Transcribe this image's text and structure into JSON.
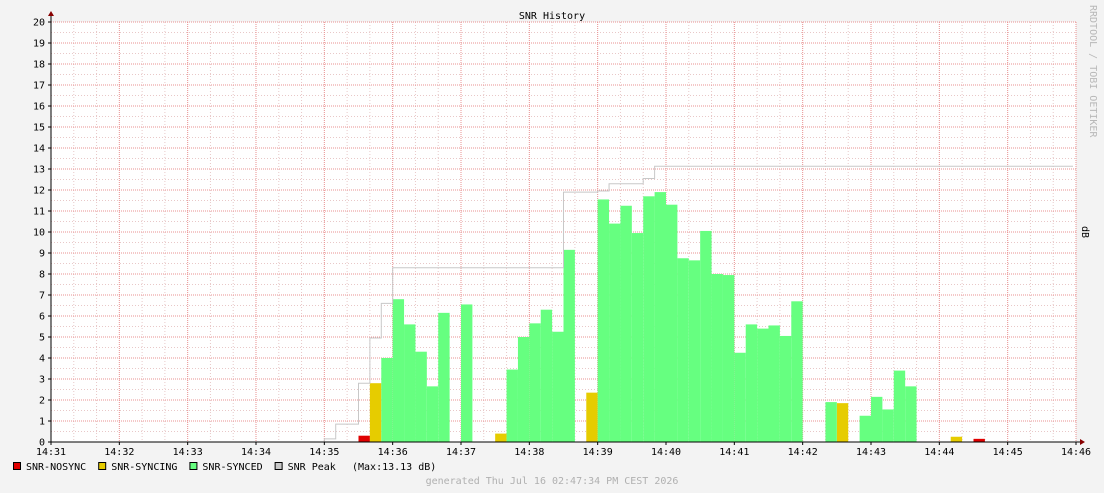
{
  "chart_data": {
    "type": "bar",
    "title": "SNR History",
    "ylabel": "dB",
    "ylim": [
      0,
      20
    ],
    "yticks": [
      0,
      1,
      2,
      3,
      4,
      5,
      6,
      7,
      8,
      9,
      10,
      11,
      12,
      13,
      14,
      15,
      16,
      17,
      18,
      19,
      20
    ],
    "xlim": [
      "14:31",
      "14:46"
    ],
    "xticks": [
      "14:31",
      "14:32",
      "14:33",
      "14:34",
      "14:35",
      "14:36",
      "14:37",
      "14:38",
      "14:39",
      "14:40",
      "14:41",
      "14:42",
      "14:43",
      "14:44",
      "14:45",
      "14:46"
    ],
    "grid": true,
    "colors": {
      "nosync": "#e00000",
      "syncing": "#e6cc00",
      "synced": "#66ff80",
      "peak": "#c8c8c8",
      "grid_minor": "#e8c8c8",
      "grid_major": "#e89090",
      "axis": "#000000",
      "arrow": "#880000"
    },
    "series": [
      {
        "name": "SNR-NOSYNC",
        "color": "#e00000",
        "points": [
          {
            "x": "14:35:35",
            "y": 0.3
          },
          {
            "x": "14:44:35",
            "y": 0.15
          }
        ]
      },
      {
        "name": "SNR-SYNCING",
        "color": "#e6cc00",
        "points": [
          {
            "x": "14:35:45",
            "y": 2.8
          },
          {
            "x": "14:37:35",
            "y": 0.4
          },
          {
            "x": "14:38:55",
            "y": 2.35
          },
          {
            "x": "14:42:35",
            "y": 1.85
          },
          {
            "x": "14:44:15",
            "y": 0.25
          }
        ]
      },
      {
        "name": "SNR-SYNCED",
        "color": "#66ff80",
        "points": [
          {
            "x": "14:35:55",
            "y": 4.0
          },
          {
            "x": "14:36:05",
            "y": 6.8
          },
          {
            "x": "14:36:15",
            "y": 5.6
          },
          {
            "x": "14:36:25",
            "y": 4.3
          },
          {
            "x": "14:36:35",
            "y": 2.65
          },
          {
            "x": "14:36:45",
            "y": 6.15
          },
          {
            "x": "14:37:05",
            "y": 6.55
          },
          {
            "x": "14:37:45",
            "y": 3.45
          },
          {
            "x": "14:37:55",
            "y": 5.0
          },
          {
            "x": "14:38:05",
            "y": 5.65
          },
          {
            "x": "14:38:15",
            "y": 6.3
          },
          {
            "x": "14:38:25",
            "y": 5.25
          },
          {
            "x": "14:38:35",
            "y": 9.15
          },
          {
            "x": "14:39:05",
            "y": 11.55
          },
          {
            "x": "14:39:15",
            "y": 10.4
          },
          {
            "x": "14:39:25",
            "y": 11.25
          },
          {
            "x": "14:39:35",
            "y": 9.95
          },
          {
            "x": "14:39:45",
            "y": 11.7
          },
          {
            "x": "14:39:55",
            "y": 11.9
          },
          {
            "x": "14:40:05",
            "y": 11.3
          },
          {
            "x": "14:40:15",
            "y": 8.75
          },
          {
            "x": "14:40:25",
            "y": 8.65
          },
          {
            "x": "14:40:35",
            "y": 10.05
          },
          {
            "x": "14:40:45",
            "y": 8.0
          },
          {
            "x": "14:40:55",
            "y": 7.95
          },
          {
            "x": "14:41:05",
            "y": 4.25
          },
          {
            "x": "14:41:15",
            "y": 5.6
          },
          {
            "x": "14:41:25",
            "y": 5.4
          },
          {
            "x": "14:41:35",
            "y": 5.55
          },
          {
            "x": "14:41:45",
            "y": 5.05
          },
          {
            "x": "14:41:55",
            "y": 6.7
          },
          {
            "x": "14:42:25",
            "y": 1.9
          },
          {
            "x": "14:42:55",
            "y": 1.25
          },
          {
            "x": "14:43:05",
            "y": 2.15
          },
          {
            "x": "14:43:15",
            "y": 1.55
          },
          {
            "x": "14:43:25",
            "y": 3.4
          },
          {
            "x": "14:43:35",
            "y": 2.65
          }
        ]
      },
      {
        "name": "SNR Peak",
        "color": "#c8c8c8",
        "steps": [
          {
            "x": "14:35:05",
            "y": 0.15
          },
          {
            "x": "14:35:15",
            "y": 0.85
          },
          {
            "x": "14:35:35",
            "y": 2.8
          },
          {
            "x": "14:35:45",
            "y": 4.95
          },
          {
            "x": "14:35:55",
            "y": 6.6
          },
          {
            "x": "14:36:05",
            "y": 8.3
          },
          {
            "x": "14:38:35",
            "y": 11.9
          },
          {
            "x": "14:39:05",
            "y": 11.95
          },
          {
            "x": "14:39:15",
            "y": 12.3
          },
          {
            "x": "14:39:45",
            "y": 12.55
          },
          {
            "x": "14:39:55",
            "y": 13.13
          },
          {
            "x": "14:46:00",
            "y": 13.13
          }
        ]
      }
    ],
    "legend": [
      {
        "label": "SNR-NOSYNC",
        "color": "#e00000"
      },
      {
        "label": "SNR-SYNCING",
        "color": "#e6cc00"
      },
      {
        "label": "SNR-SYNCED",
        "color": "#66ff80"
      },
      {
        "label": "SNR Peak",
        "color": "#c8c8c8"
      }
    ],
    "legend_note": "(Max:13.13 dB)",
    "legend_position": "bottom-left",
    "watermark": "RRDTOOL / TOBI OETIKER",
    "footer": "generated Thu Jul 16 02:47:34 PM CEST 2026"
  }
}
